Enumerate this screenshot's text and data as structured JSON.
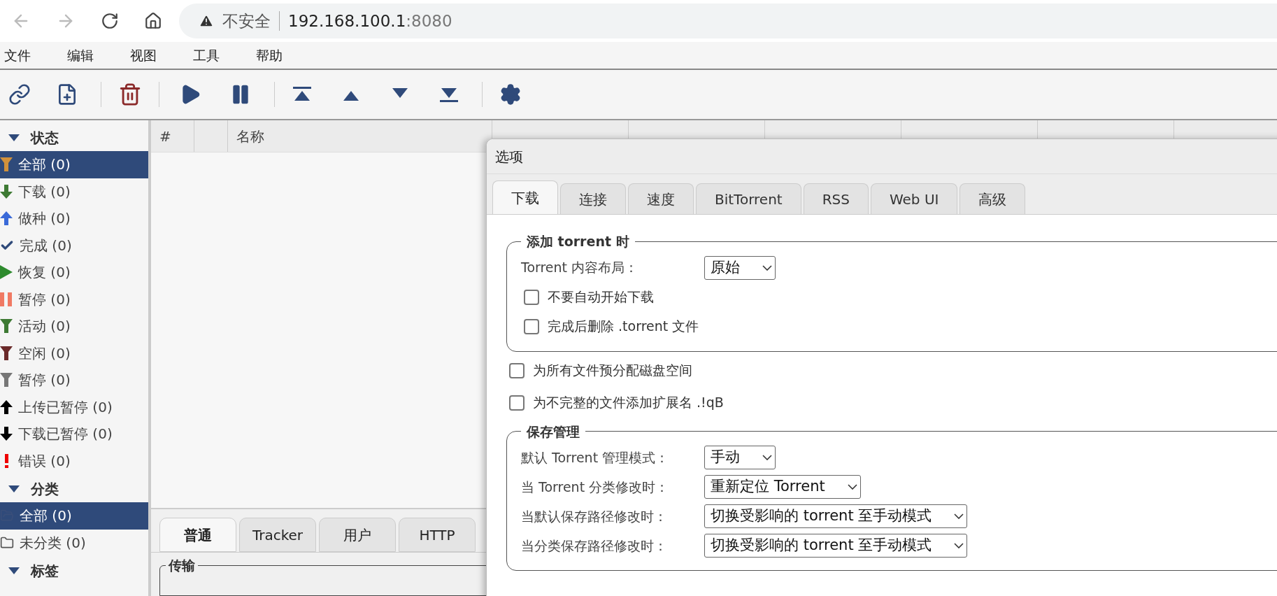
{
  "browser": {
    "security": "不安全",
    "host": "192.168.100.1",
    "port": ":8080"
  },
  "menu": [
    "文件",
    "编辑",
    "视图",
    "工具",
    "帮助"
  ],
  "sidebar": [
    {
      "title": "状态",
      "expanded": true,
      "items": [
        {
          "label": "全部 (0)",
          "kind": "all",
          "selected": true
        },
        {
          "label": "下载 (0)",
          "kind": "downloading",
          "selected": false
        },
        {
          "label": "做种 (0)",
          "kind": "seeding",
          "selected": false
        },
        {
          "label": "完成 (0)",
          "kind": "completed",
          "selected": false
        },
        {
          "label": "恢复 (0)",
          "kind": "resumed",
          "selected": false
        },
        {
          "label": "暂停 (0)",
          "kind": "paused",
          "selected": false
        },
        {
          "label": "活动 (0)",
          "kind": "active",
          "selected": false
        },
        {
          "label": "空闲 (0)",
          "kind": "inactive",
          "selected": false
        },
        {
          "label": "暂停 (0)",
          "kind": "stalled",
          "selected": false
        },
        {
          "label": "上传已暂停 (0)",
          "kind": "stalled_up",
          "selected": false
        },
        {
          "label": "下载已暂停 (0)",
          "kind": "stalled_down",
          "selected": false
        },
        {
          "label": "错误 (0)",
          "kind": "errored",
          "selected": false
        }
      ]
    },
    {
      "title": "分类",
      "expanded": true,
      "items": [
        {
          "label": "全部 (0)",
          "kind": "folder_all",
          "selected": true
        },
        {
          "label": "未分类 (0)",
          "kind": "folder",
          "selected": false
        }
      ]
    },
    {
      "title": "标签",
      "expanded": true
    }
  ],
  "table": {
    "columns": [
      "#",
      "名称"
    ]
  },
  "bottom_tabs": [
    {
      "label": "普通",
      "selected": true
    },
    {
      "label": "Tracker",
      "selected": false
    },
    {
      "label": "用户",
      "selected": false
    },
    {
      "label": "HTTP",
      "selected": false
    }
  ],
  "bottom_group": "传输",
  "dialog": {
    "title": "选项",
    "tabs": [
      {
        "label": "下载",
        "selected": true
      },
      {
        "label": "连接",
        "selected": false
      },
      {
        "label": "速度",
        "selected": false
      },
      {
        "label": "BitTorrent",
        "selected": false
      },
      {
        "label": "RSS",
        "selected": false
      },
      {
        "label": "Web UI",
        "selected": false
      },
      {
        "label": "高级",
        "selected": false
      }
    ],
    "content": [
      {
        "kind": "group",
        "title": "添加 torrent 时",
        "children": [
          {
            "kind": "select",
            "label": "Torrent 内容布局：",
            "value": "原始"
          },
          {
            "kind": "checkbox",
            "label": "不要自动开始下载",
            "checked": false
          },
          {
            "kind": "checkbox",
            "label": "完成后删除 .torrent 文件",
            "checked": false
          }
        ]
      },
      {
        "kind": "checkbox",
        "label": "为所有文件预分配磁盘空间",
        "checked": false
      },
      {
        "kind": "checkbox",
        "label": "为不完整的文件添加扩展名 .!qB",
        "checked": false
      },
      {
        "kind": "group",
        "title": "保存管理",
        "children": [
          {
            "kind": "select",
            "label": "默认 Torrent 管理模式：",
            "value": "手动"
          },
          {
            "kind": "select",
            "label": "当 Torrent 分类修改时：",
            "value": "重新定位 Torrent"
          },
          {
            "kind": "select",
            "label": "当默认保存路径修改时：",
            "value": "切换受影响的 torrent 至手动模式"
          },
          {
            "kind": "select",
            "label": "当分类保存路径修改时：",
            "value": "切换受影响的 torrent 至手动模式"
          }
        ]
      }
    ]
  }
}
